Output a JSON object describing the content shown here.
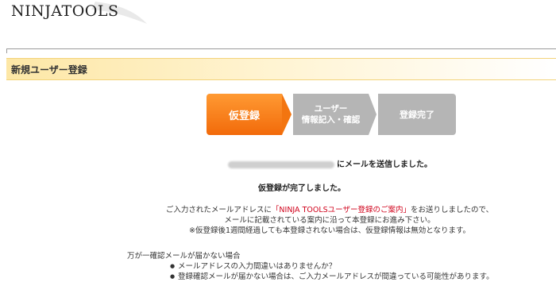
{
  "header": {
    "logo_text": "NINJATOOLS"
  },
  "section": {
    "title": "新規ユーザー登録"
  },
  "steps": [
    {
      "label": "仮登録",
      "state": "active",
      "color": "#f37510"
    },
    {
      "label_line1": "ユーザー",
      "label_line2": "情報記入・確認",
      "state": "inactive",
      "color": "#b5b5b5"
    },
    {
      "label": "登録完了",
      "state": "inactive",
      "color": "#b5b5b5"
    }
  ],
  "message": {
    "mail_sent_suffix": "にメールを送信しました。",
    "done": "仮登録が完了しました。",
    "info_line1_pre": "ご入力されたメールアドレスに",
    "info_line1_highlight": "「NINJA TOOLSユーザー登録のご案内」",
    "info_line1_post": "をお送りしましたので、",
    "info_line2": "メールに記載されている案内に沿って本登録にお進み下さい。",
    "info_line3": "※仮登録後1週間経過しても本登録されない場合は、仮登録情報は無効となります。"
  },
  "trouble": {
    "heading": "万が一確認メールが届かない場合",
    "items": [
      "メールアドレスの入力間違いはありませんか？",
      "登録確認メールが届かない場合は、ご入力メールアドレスが間違っている可能性があります。"
    ]
  },
  "colors": {
    "accent": "#f37510",
    "highlight": "#d0021b",
    "section_bar": "#fde7a6"
  }
}
